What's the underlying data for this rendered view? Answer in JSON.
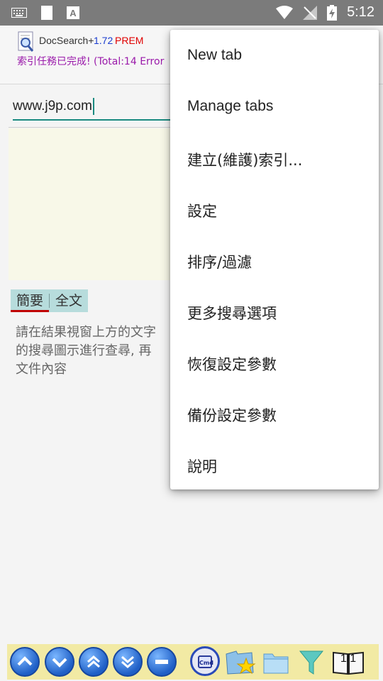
{
  "statusbar": {
    "time": "5:12"
  },
  "header": {
    "app_name": "DocSearch+",
    "version": "1.72",
    "edition": "PREM",
    "status_message": "索引任務已完成! (Total:14 Error"
  },
  "search": {
    "value": "www.j9p.com"
  },
  "tabs": [
    {
      "label": "簡要"
    },
    {
      "label": "全文"
    }
  ],
  "hint": "請在結果視窗上方的文字\n的搜尋圖示進行查尋, 再\n文件內容",
  "toolbar": {
    "page_indicator": "1/1"
  },
  "menu": {
    "items": [
      {
        "label": "New tab"
      },
      {
        "label": "Manage tabs"
      },
      {
        "label": "建立(維護)索引..."
      },
      {
        "label": "設定"
      },
      {
        "label": "排序/過濾"
      },
      {
        "label": "更多搜尋選項"
      },
      {
        "label": "恢復設定參數"
      },
      {
        "label": "備份設定參數"
      },
      {
        "label": "說明"
      }
    ]
  },
  "colors": {
    "accent": "#1a8a80",
    "status_message": "#9a1aaa",
    "toolbar_bg": "#f2eaa4"
  }
}
